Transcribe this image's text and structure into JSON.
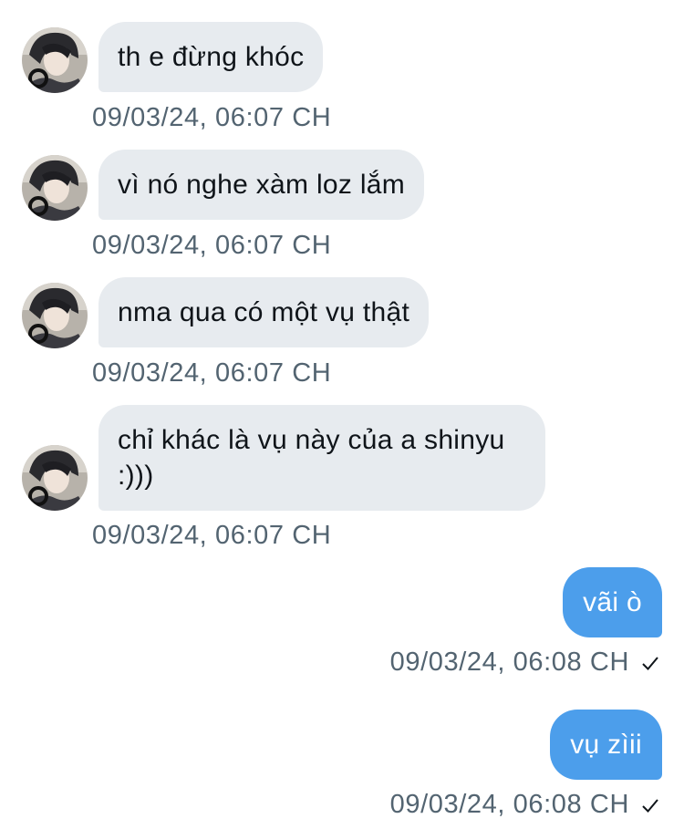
{
  "conversation": {
    "messages": [
      {
        "direction": "incoming",
        "text": "th e đừng khóc",
        "time": "09/03/24, 06:07 CH"
      },
      {
        "direction": "incoming",
        "text": "vì nó nghe xàm loz lắm",
        "time": "09/03/24, 06:07 CH"
      },
      {
        "direction": "incoming",
        "text": "nma qua có một vụ thật",
        "time": "09/03/24, 06:07 CH"
      },
      {
        "direction": "incoming",
        "text": "chỉ khác là vụ này của a shinyu :)))",
        "time": "09/03/24, 06:07 CH"
      },
      {
        "direction": "outgoing",
        "text": "vãi ò",
        "time": "09/03/24, 06:08 CH",
        "status_icon": "checkmark-icon"
      },
      {
        "direction": "outgoing",
        "text": "vụ zìii",
        "time": "09/03/24, 06:08 CH",
        "status_icon": "checkmark-icon"
      }
    ]
  },
  "colors": {
    "incoming_bubble": "#e7ebef",
    "outgoing_bubble": "#4c9eeb",
    "timestamp": "#536471",
    "text_dark": "#0f1419"
  }
}
